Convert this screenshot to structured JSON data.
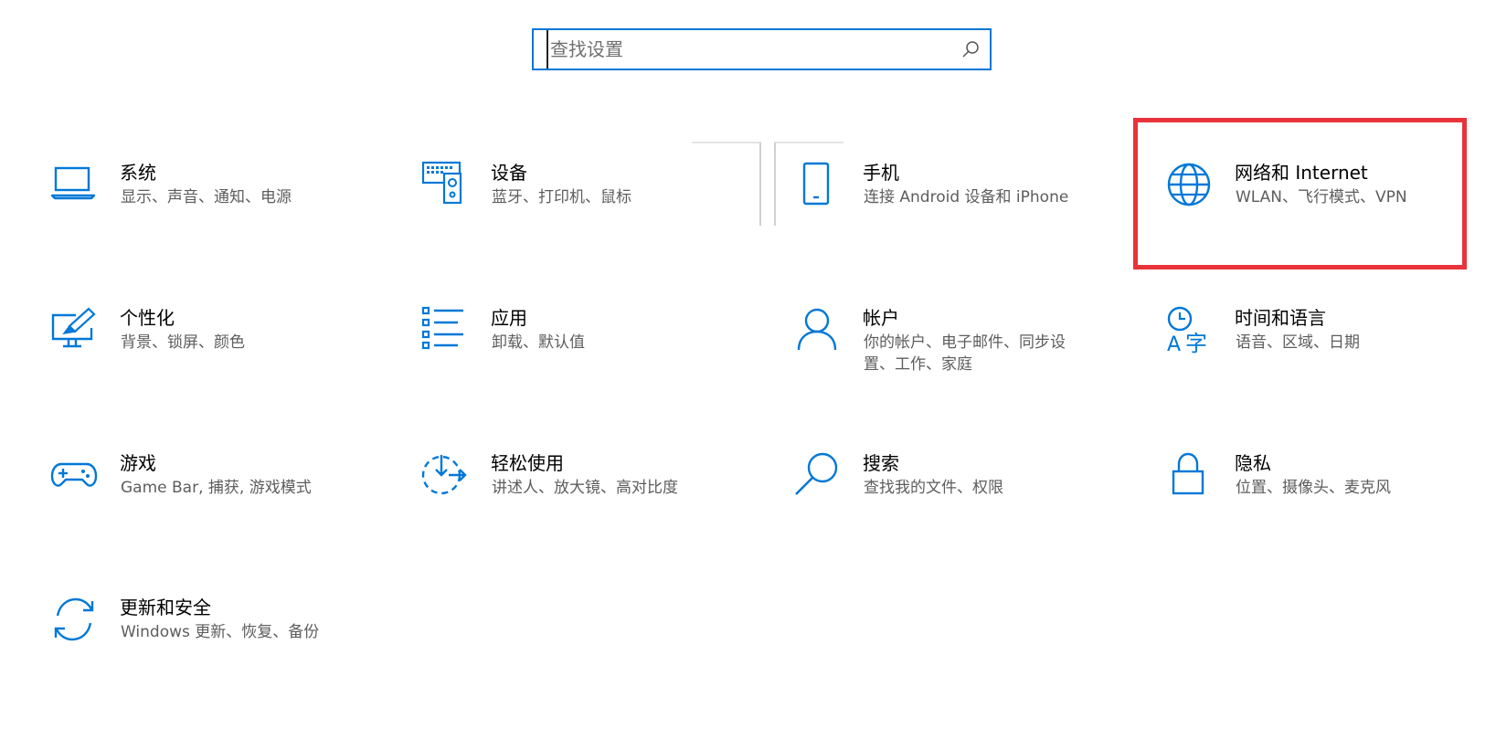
{
  "search": {
    "placeholder": "查找设置"
  },
  "colors": {
    "accent": "#0078d7",
    "highlight": "#e8333a",
    "description": "#5d5d5d"
  },
  "tiles": [
    {
      "title": "系统",
      "desc": "显示、声音、通知、电源",
      "icon": "laptop-icon"
    },
    {
      "title": "设备",
      "desc": "蓝牙、打印机、鼠标",
      "icon": "keyboard-speaker-icon"
    },
    {
      "title": "手机",
      "desc": "连接 Android 设备和 iPhone",
      "icon": "phone-icon"
    },
    {
      "title": "网络和 Internet",
      "desc": "WLAN、飞行模式、VPN",
      "icon": "globe-icon"
    },
    {
      "title": "个性化",
      "desc": "背景、锁屏、颜色",
      "icon": "paintbrush-monitor-icon"
    },
    {
      "title": "应用",
      "desc": "卸载、默认值",
      "icon": "apps-list-icon"
    },
    {
      "title": "帐户",
      "desc": "你的帐户、电子邮件、同步设置、工作、家庭",
      "icon": "person-icon"
    },
    {
      "title": "时间和语言",
      "desc": "语音、区域、日期",
      "icon": "time-language-icon"
    },
    {
      "title": "游戏",
      "desc": "Game Bar, 捕获, 游戏模式",
      "icon": "gamepad-icon"
    },
    {
      "title": "轻松使用",
      "desc": "讲述人、放大镜、高对比度",
      "icon": "ease-of-access-icon"
    },
    {
      "title": "搜索",
      "desc": "查找我的文件、权限",
      "icon": "search-magnifier-icon"
    },
    {
      "title": "隐私",
      "desc": "位置、摄像头、麦克风",
      "icon": "lock-icon"
    },
    {
      "title": "更新和安全",
      "desc": "Windows 更新、恢复、备份",
      "icon": "sync-arrows-icon"
    }
  ]
}
